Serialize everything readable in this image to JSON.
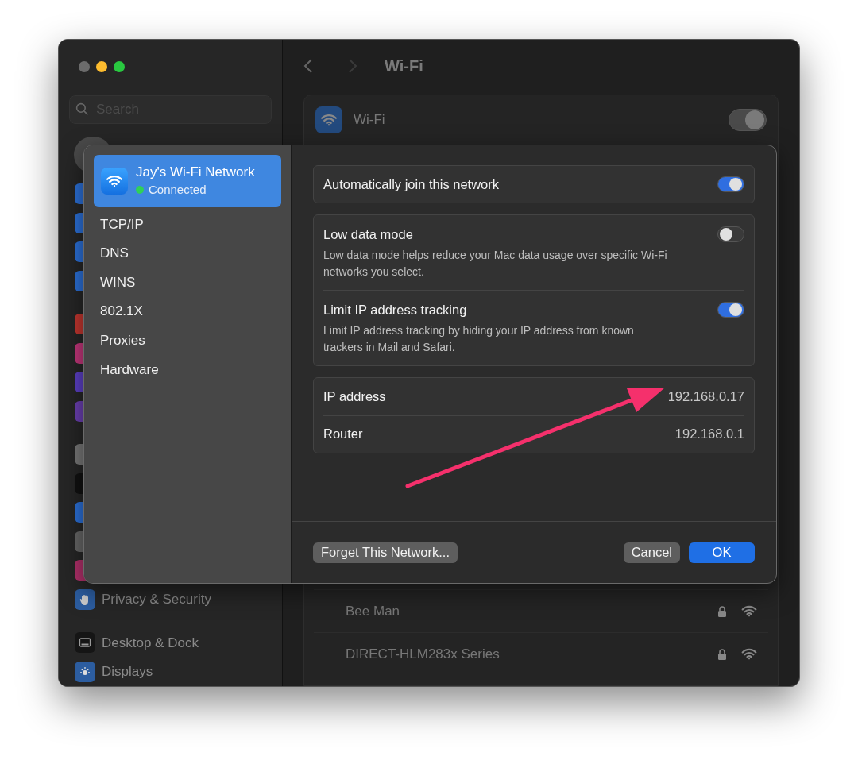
{
  "sidebar": {
    "search": {
      "placeholder": "Search"
    },
    "items": [
      {
        "label": "Privacy & Security",
        "kind": "hand"
      },
      {
        "label": "Desktop & Dock",
        "kind": "dock"
      },
      {
        "label": "Displays",
        "kind": "sun"
      }
    ]
  },
  "main": {
    "title": "Wi-Fi",
    "wifi": {
      "label": "Wi-Fi",
      "on": true
    },
    "networks": [
      {
        "name": "Bee Man",
        "locked": true
      },
      {
        "name": "DIRECT-HLM283x Series",
        "locked": true
      }
    ]
  },
  "sheet": {
    "items": [
      {
        "kind": "network",
        "label": "Jay's Wi-Fi Network",
        "status": "Connected",
        "connected": true,
        "selected": true
      },
      {
        "label": "TCP/IP",
        "selected": false
      },
      {
        "label": "DNS",
        "selected": false
      },
      {
        "label": "WINS",
        "selected": false
      },
      {
        "label": "802.1X",
        "selected": false
      },
      {
        "label": "Proxies",
        "selected": false
      },
      {
        "label": "Hardware",
        "selected": false
      }
    ],
    "groups": [
      [
        {
          "label": "Automatically join this network",
          "on": true
        }
      ],
      [
        {
          "label": "Low data mode",
          "description": "Low data mode helps reduce your Mac data usage over specific Wi-Fi networks you select.",
          "on": false
        },
        {
          "label": "Limit IP address tracking",
          "description": "Limit IP address tracking by hiding your IP address from known trackers in Mail and Safari.",
          "on": true
        }
      ]
    ],
    "info": [
      {
        "label": "IP address",
        "value": "192.168.0.17"
      },
      {
        "label": "Router",
        "value": "192.168.0.1"
      }
    ],
    "buttons": [
      {
        "label": "Forget This Network...",
        "kind": "secondary"
      },
      {
        "label": "Cancel",
        "kind": "secondary"
      },
      {
        "label": "OK",
        "kind": "primary"
      }
    ]
  }
}
